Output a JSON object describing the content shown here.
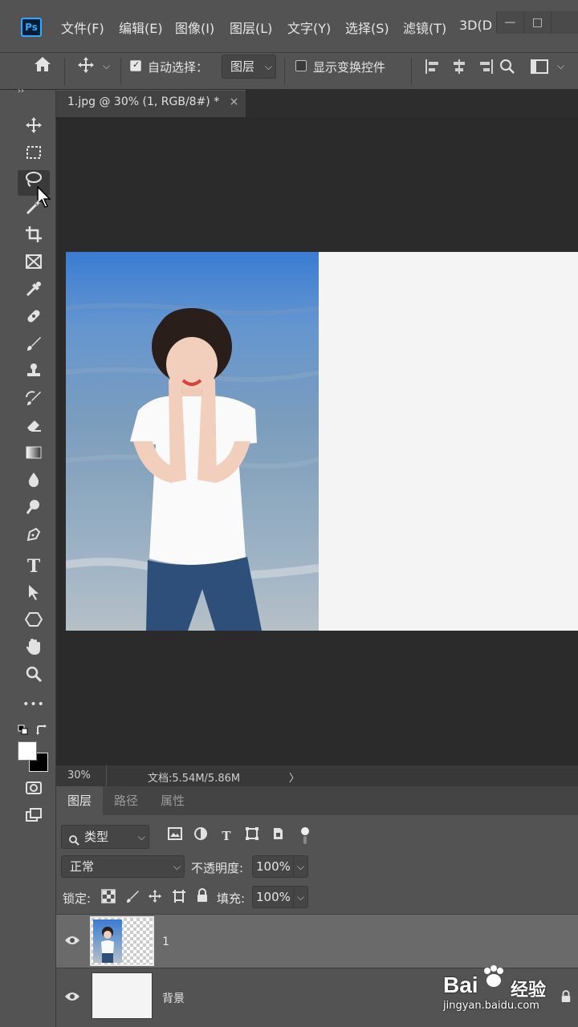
{
  "app": {
    "logo": "Ps",
    "menu": [
      "文件(F)",
      "编辑(E)",
      "图像(I)",
      "图层(L)",
      "文字(Y)",
      "选择(S)",
      "滤镜(T)",
      "3D(D"
    ],
    "window_buttons": [
      "—",
      "□"
    ]
  },
  "options_bar": {
    "auto_select_label": "自动选择：",
    "auto_select_checked": true,
    "auto_select_target": "图层",
    "show_transform_label": "显示变换控件",
    "show_transform_checked": false
  },
  "document": {
    "tab_title": "1.jpg @ 30% (1, RGB/8#) *",
    "tab_close": "×",
    "zoom": "30%",
    "doc_info": "文档:5.54M/5.86M",
    "status_arrow": "〉"
  },
  "toolbar": {
    "collapse": "››",
    "tools": [
      "move",
      "marquee",
      "lasso",
      "magic-wand",
      "crop",
      "frame",
      "eyedropper",
      "healing",
      "brush",
      "stamp",
      "history-brush",
      "eraser",
      "gradient",
      "blur",
      "dodge",
      "pen",
      "type",
      "path-select",
      "shape",
      "hand",
      "zoom",
      "more"
    ],
    "active_tool": "lasso",
    "type_glyph": "T",
    "more_glyph": "•••"
  },
  "panel": {
    "tabs": [
      "图层",
      "路径",
      "属性"
    ],
    "active_tab": "图层",
    "filter_label": "类型",
    "blend_mode": "正常",
    "opacity_label": "不透明度:",
    "opacity_value": "100%",
    "lock_label": "锁定:",
    "fill_label": "填充:",
    "fill_value": "100%",
    "layers": [
      {
        "name": "1",
        "selected": true
      },
      {
        "name": "背景",
        "selected": false
      }
    ]
  },
  "watermark": {
    "brand": "Bai",
    "brand2": "经验",
    "url": "jingyan.baidu.com"
  },
  "colors": {
    "chrome": "#535353",
    "canvas_bg": "#2b2b2b",
    "accent": "#31a8ff"
  }
}
